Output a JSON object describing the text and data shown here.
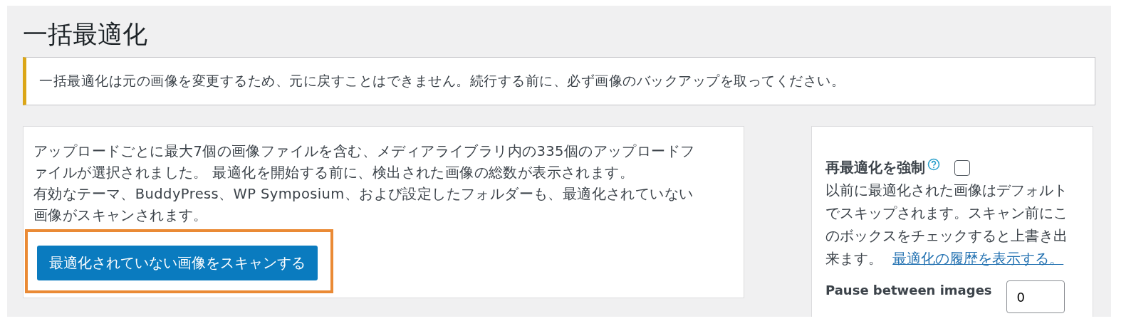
{
  "title": "一括最適化",
  "notice": {
    "text": "一括最適化は元の画像を変更するため、元に戻すことはできません。続行する前に、必ず画像のバックアップを取ってください。"
  },
  "scan_panel": {
    "paragraphs": [
      "アップロードごとに最大7個の画像ファイルを含む、メディアライブラリ内の335個のアップロードファイルが選択されました。 最適化を開始する前に、検出された画像の総数が表示されます。",
      "有効なテーマ、BuddyPress、WP Symposium、および設定したフォルダーも、最適化されていない画像がスキャンされます。"
    ],
    "button": {
      "label": "最適化されていない画像をスキャンする",
      "highlighted": true
    }
  },
  "options_panel": {
    "force_label": "再最適化を強制",
    "force_checked": false,
    "force_description": "以前に最適化された画像はデフォルトでスキップされます。スキャン前にこのボックスをチェックすると上書き出来ます。",
    "history_link": "最適化の履歴を表示する。",
    "pause_label": "Pause between images",
    "pause_value": "0"
  }
}
